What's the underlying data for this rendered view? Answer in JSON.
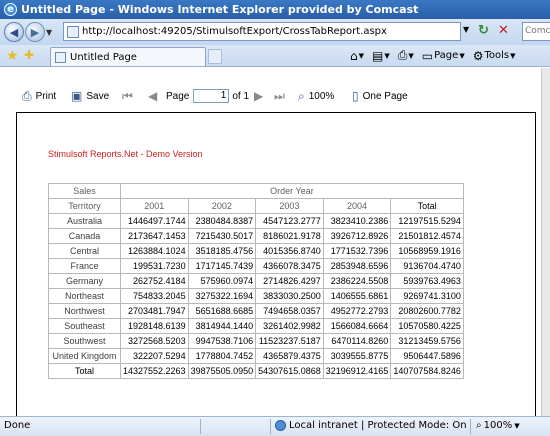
{
  "window": {
    "title": "Untitled Page - Windows Internet Explorer provided by Comcast"
  },
  "address_bar": {
    "url": "http://localhost:49205/StimulsoftExport/CrossTabReport.aspx",
    "search_text": "Comcast"
  },
  "tabs": [
    {
      "label": "Untitled Page"
    }
  ],
  "command_bar": {
    "page_label": "Page",
    "tools_label": "Tools"
  },
  "viewer_toolbar": {
    "print_label": "Print",
    "save_label": "Save",
    "page_label": "Page",
    "page_value": "1",
    "of_label": "of 1",
    "zoom_label": "100%",
    "one_page_label": "One Page"
  },
  "report": {
    "demo_text": "Stimulsoft Reports.Net - Demo Version",
    "corner_label": "Sales",
    "group_header": "Order Year",
    "row_header_label": "Territory",
    "columns": [
      "2001",
      "2002",
      "2003",
      "2004",
      "Total"
    ],
    "rows": [
      {
        "territory": "Australia",
        "values": [
          "1446497.1744",
          "2380484.8387",
          "4547123.2777",
          "3823410.2386",
          "12197515.5294"
        ]
      },
      {
        "territory": "Canada",
        "values": [
          "2173647.1453",
          "7215430.5017",
          "8186021.9178",
          "3926712.8926",
          "21501812.4574"
        ]
      },
      {
        "territory": "Central",
        "values": [
          "1263884.1024",
          "3518185.4756",
          "4015356.8740",
          "1771532.7396",
          "10568959.1916"
        ]
      },
      {
        "territory": "France",
        "values": [
          "199531.7230",
          "1717145.7439",
          "4366078.3475",
          "2853948.6596",
          "9136704.4740"
        ]
      },
      {
        "territory": "Germany",
        "values": [
          "262752.4184",
          "575960.0974",
          "2714826.4297",
          "2386224.5508",
          "5939763.4963"
        ]
      },
      {
        "territory": "Northeast",
        "values": [
          "754833.2045",
          "3275322.1694",
          "3833030.2500",
          "1406555.6861",
          "9269741.3100"
        ]
      },
      {
        "territory": "Northwest",
        "values": [
          "2703481.7947",
          "5651688.6685",
          "7494658.0357",
          "4952772.2793",
          "20802600.7782"
        ]
      },
      {
        "territory": "Southeast",
        "values": [
          "1928148.6139",
          "3814944.1440",
          "3261402.9982",
          "1566084.6664",
          "10570580.4225"
        ]
      },
      {
        "territory": "Southwest",
        "values": [
          "3272568.5203",
          "9947538.7106",
          "11523237.5187",
          "6470114.8260",
          "31213459.5756"
        ]
      },
      {
        "territory": "United Kingdom",
        "values": [
          "322207.5294",
          "1778804.7452",
          "4365879.4375",
          "3039555.8775",
          "9506447.5896"
        ]
      }
    ],
    "totals": {
      "label": "Total",
      "values": [
        "14327552.2263",
        "39875505.0950",
        "54307615.0868",
        "32196912.4165",
        "140707584.8246"
      ]
    }
  },
  "status_bar": {
    "status": "Done",
    "zone": "Local intranet | Protected Mode: On",
    "zoom": "100%"
  }
}
